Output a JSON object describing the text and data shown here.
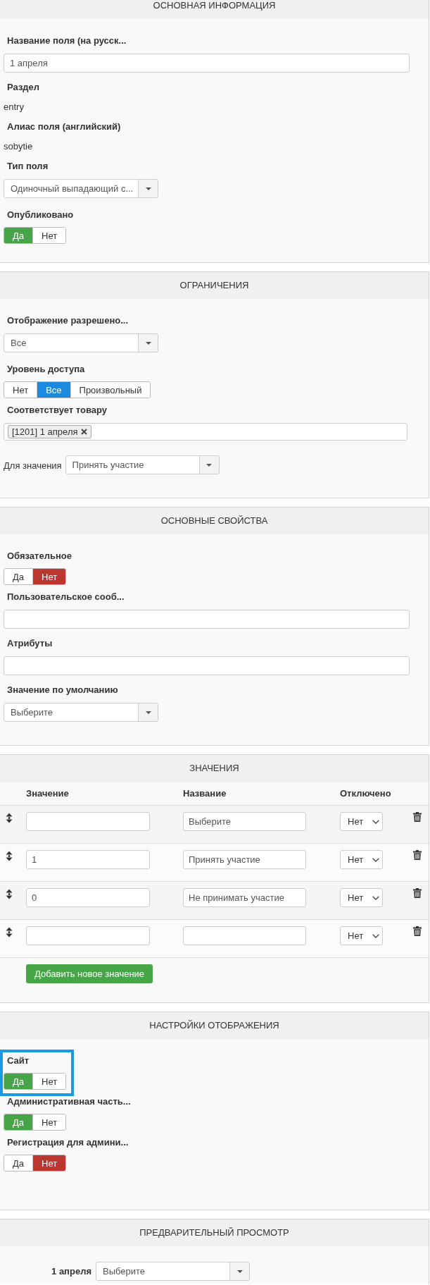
{
  "sections": [
    {
      "kind": "form",
      "title": "ОСНОВНАЯ ИНФОРМАЦИЯ",
      "fields": [
        {
          "kind": "input",
          "label": "Название поля (на русск...",
          "value": "1 апреля"
        },
        {
          "kind": "static",
          "label": "Раздел",
          "value": "entry"
        },
        {
          "kind": "static",
          "label": "Алиас поля (английский)",
          "value": "sobytie"
        },
        {
          "kind": "select",
          "label": "Тип поля",
          "value": "Одиночный выпадающий с..."
        },
        {
          "kind": "toggle",
          "label": "Опубликовано",
          "options": [
            {
              "label": "Да",
              "selected": true,
              "color": "#46a546"
            },
            {
              "label": "Нет",
              "selected": false
            }
          ]
        }
      ]
    },
    {
      "kind": "form",
      "title": "ОГРАНИЧЕНИЯ",
      "fields": [
        {
          "kind": "select",
          "label": "Отображение разрешено...",
          "value": "Все"
        },
        {
          "kind": "toggle",
          "label": "Уровень доступа",
          "options": [
            {
              "label": "Нет",
              "selected": false
            },
            {
              "label": "Все",
              "selected": true,
              "color": "#1c8ade"
            },
            {
              "label": "Произвольный",
              "selected": false
            }
          ]
        },
        {
          "kind": "tags",
          "label": "Соответствует товару",
          "tags": [
            "[1201] 1 апреля"
          ]
        },
        {
          "kind": "inline_select",
          "label": "Для значения",
          "value": "Принять участие"
        }
      ]
    },
    {
      "kind": "form",
      "title": "ОСНОВНЫЕ СВОЙСТВА",
      "fields": [
        {
          "kind": "toggle",
          "label": "Обязательное",
          "options": [
            {
              "label": "Да",
              "selected": false
            },
            {
              "label": "Нет",
              "selected": true,
              "color": "#bd362f"
            }
          ]
        },
        {
          "kind": "input",
          "label": "Пользовательское сооб..."
        },
        {
          "kind": "input",
          "label": "Атрибуты"
        },
        {
          "kind": "select",
          "label": "Значение по умолчанию",
          "value": "Выберите"
        }
      ]
    },
    {
      "kind": "table",
      "title": "ЗНАЧЕНИЯ",
      "columns": [
        "Значение",
        "Название",
        "Отключено"
      ],
      "rows": [
        {
          "name": "Выберите",
          "disabled": "Нет"
        },
        {
          "value": "1",
          "name": "Принять участие",
          "disabled": "Нет"
        },
        {
          "value": "0",
          "name": "Не принимать участие",
          "disabled": "Нет"
        },
        {
          "disabled": "Нет"
        }
      ],
      "add_button": "Добавить новое значение"
    },
    {
      "kind": "form",
      "title": "НАСТРОЙКИ ОТОБРАЖЕНИЯ",
      "fields": [
        {
          "kind": "toggle",
          "label": "Сайт",
          "highlighted": true,
          "options": [
            {
              "label": "Да",
              "selected": true,
              "color": "#46a546"
            },
            {
              "label": "Нет",
              "selected": false
            }
          ]
        },
        {
          "kind": "toggle",
          "label": "Административная часть...",
          "options": [
            {
              "label": "Да",
              "selected": true,
              "color": "#46a546"
            },
            {
              "label": "Нет",
              "selected": false
            }
          ]
        },
        {
          "kind": "toggle",
          "label": "Регистрация для админи...",
          "options": [
            {
              "label": "Да",
              "selected": false
            },
            {
              "label": "Нет",
              "selected": true,
              "color": "#bd362f"
            }
          ]
        }
      ]
    },
    {
      "kind": "preview",
      "title": "ПРЕДВАРИТЕЛЬНЫЙ ПРОСМОТР",
      "label": "1 апреля",
      "value": "Выберите"
    }
  ]
}
